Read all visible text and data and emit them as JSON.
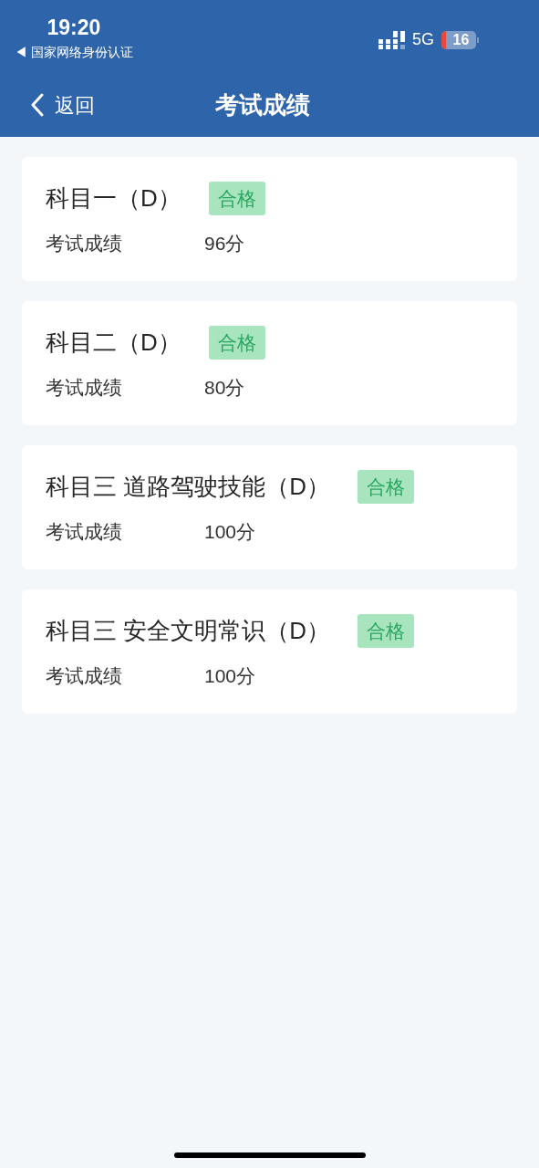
{
  "status_bar": {
    "time": "19:20",
    "back_app": "◀ 国家网络身份认证",
    "network": "5G",
    "battery": "16"
  },
  "nav": {
    "back": "返回",
    "title": "考试成绩"
  },
  "results": [
    {
      "subject": "科目一（D）",
      "status": "合格",
      "label": "考试成绩",
      "score": "96分"
    },
    {
      "subject": "科目二（D）",
      "status": "合格",
      "label": "考试成绩",
      "score": "80分"
    },
    {
      "subject": "科目三 道路驾驶技能（D）",
      "status": "合格",
      "label": "考试成绩",
      "score": "100分"
    },
    {
      "subject": "科目三 安全文明常识（D）",
      "status": "合格",
      "label": "考试成绩",
      "score": "100分"
    }
  ]
}
